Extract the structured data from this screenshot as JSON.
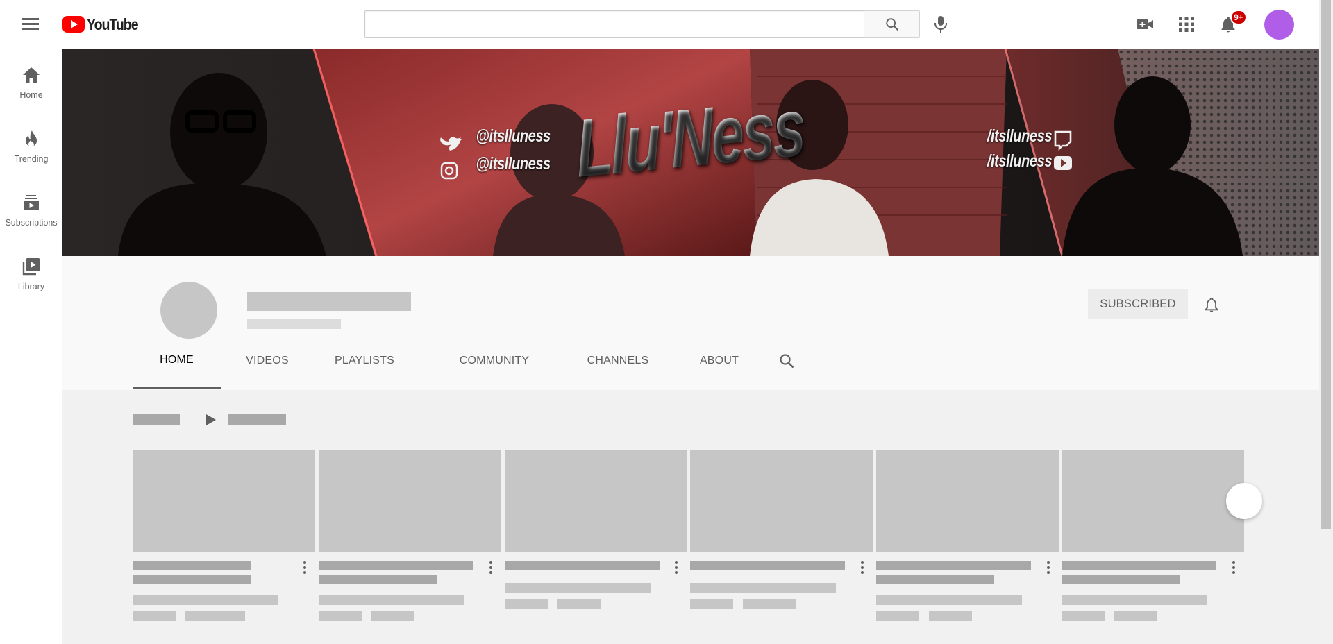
{
  "topbar": {
    "logo_text": "YouTube",
    "search_placeholder": "",
    "search_value": "",
    "notification_count": "9+"
  },
  "sidebar": {
    "items": [
      {
        "label": "Home",
        "icon": "home-icon"
      },
      {
        "label": "Trending",
        "icon": "flame-icon"
      },
      {
        "label": "Subscriptions",
        "icon": "subscriptions-icon"
      },
      {
        "label": "Library",
        "icon": "library-icon"
      }
    ]
  },
  "banner": {
    "title": "Llu'Ness",
    "twitter_handle": "@itslluness",
    "instagram_handle": "@itslluness",
    "twitch_handle": "/itslluness",
    "youtube_handle": "/itslluness"
  },
  "channel": {
    "subscribe_label": "SUBSCRIBED",
    "tabs": [
      "HOME",
      "VIDEOS",
      "PLAYLISTS",
      "COMMUNITY",
      "CHANNELS",
      "ABOUT"
    ],
    "active_tab": "HOME"
  },
  "colors": {
    "accent": "#ff0000",
    "avatar": "#b05ee8",
    "badge": "#cc0000",
    "placeholder": "#c6c6c6"
  }
}
